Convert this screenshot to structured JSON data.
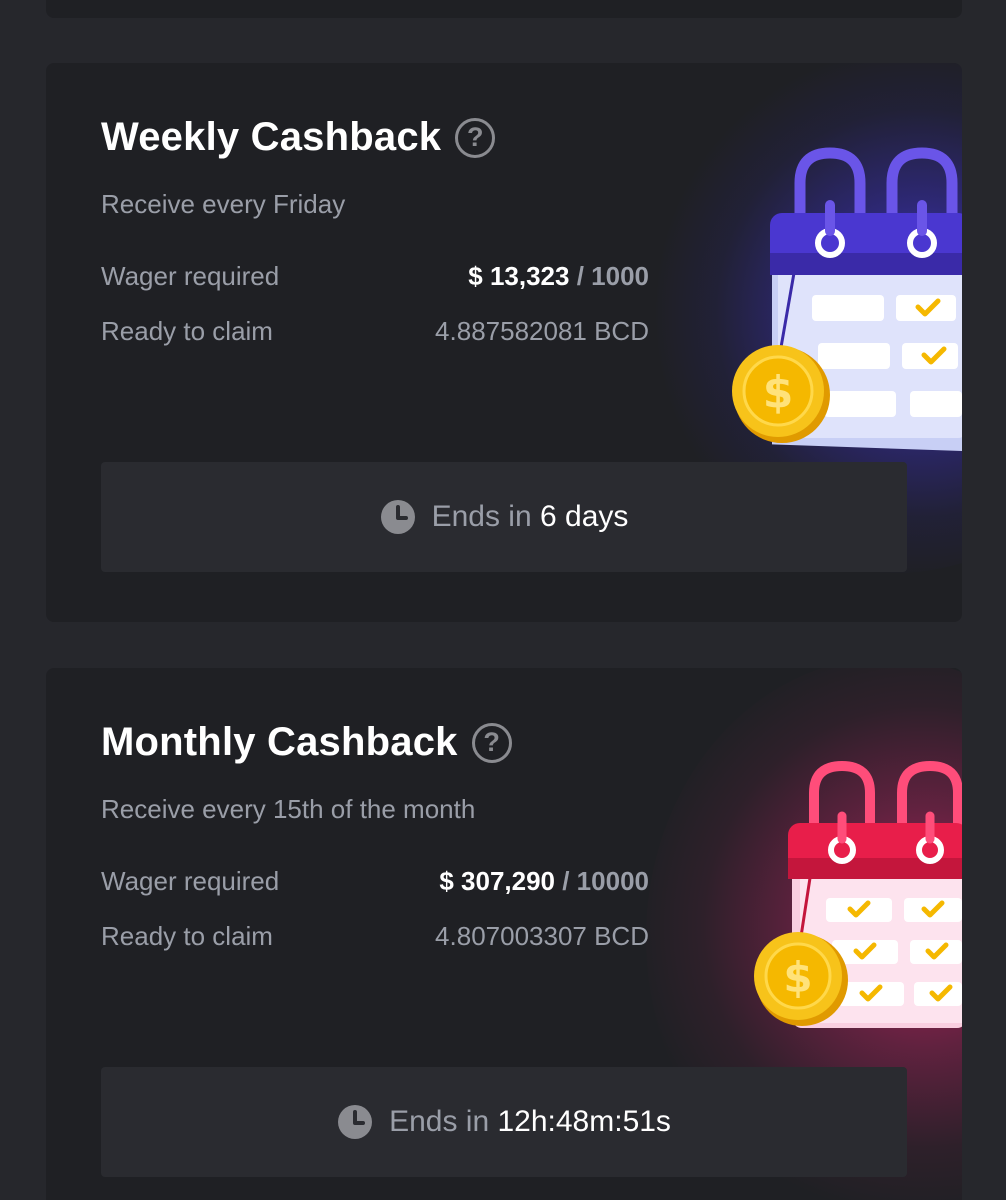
{
  "weekly": {
    "title": "Weekly Cashback",
    "subtitle": "Receive every Friday",
    "wager_label": "Wager required",
    "wager_current": "$ 13,323",
    "wager_target": " / 1000",
    "claim_label": "Ready to claim",
    "claim_amount": "4.887582081 BCD",
    "ends_label": "Ends in",
    "ends_value": "6 days"
  },
  "monthly": {
    "title": "Monthly Cashback",
    "subtitle": "Receive every 15th of the month",
    "wager_label": "Wager required",
    "wager_current": "$ 307,290",
    "wager_target": " / 10000",
    "claim_label": "Ready to claim",
    "claim_amount": "4.807003307 BCD",
    "ends_label": "Ends in",
    "ends_value": "12h:48m:51s"
  },
  "icons": {
    "help": "question-circle-icon",
    "clock": "clock-icon",
    "illustration": "calendar-coin-illustration"
  },
  "colors": {
    "page_bg": "#26272c",
    "card_bg": "#1f2024",
    "timer_bg": "#2a2b30",
    "text_primary": "#ffffff",
    "text_secondary": "#9a9ea8",
    "weekly_accent": "#4b3fd6",
    "monthly_accent": "#e0245e",
    "coin": "#f5b800"
  },
  "help_glyph": "?"
}
